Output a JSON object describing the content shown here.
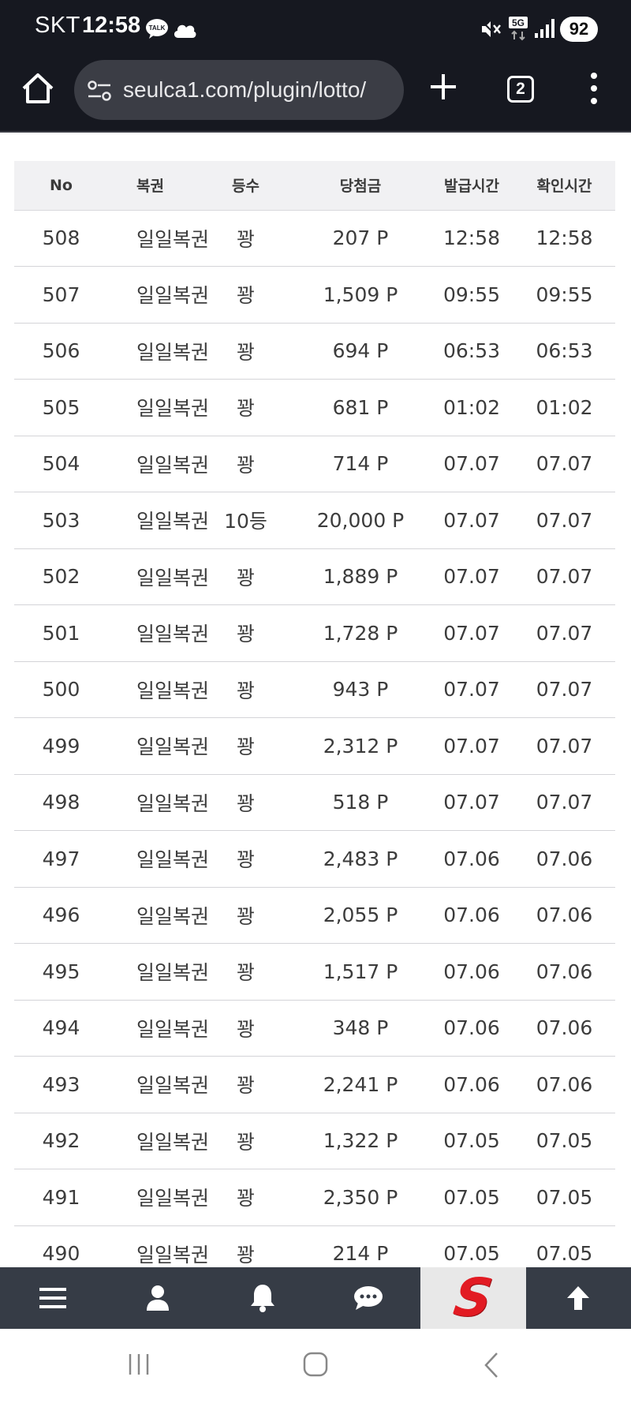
{
  "status_bar": {
    "carrier": "SKT",
    "time": "12:58",
    "talk_badge": "TALK",
    "network": "5G",
    "battery": "92"
  },
  "browser": {
    "url": "seulca1.com/plugin/lotto/",
    "tab_count": "2"
  },
  "table": {
    "headers": {
      "no": "No",
      "type": "복권",
      "rank": "등수",
      "prize": "당첨금",
      "issued": "발급시간",
      "checked": "확인시간"
    },
    "rows": [
      {
        "no": "508",
        "type": "일일복권",
        "rank": "꽝",
        "prize": "207 P",
        "issued": "12:58",
        "checked": "12:58"
      },
      {
        "no": "507",
        "type": "일일복권",
        "rank": "꽝",
        "prize": "1,509 P",
        "issued": "09:55",
        "checked": "09:55"
      },
      {
        "no": "506",
        "type": "일일복권",
        "rank": "꽝",
        "prize": "694 P",
        "issued": "06:53",
        "checked": "06:53"
      },
      {
        "no": "505",
        "type": "일일복권",
        "rank": "꽝",
        "prize": "681 P",
        "issued": "01:02",
        "checked": "01:02"
      },
      {
        "no": "504",
        "type": "일일복권",
        "rank": "꽝",
        "prize": "714 P",
        "issued": "07.07",
        "checked": "07.07"
      },
      {
        "no": "503",
        "type": "일일복권",
        "rank": "10등",
        "prize": "20,000 P",
        "issued": "07.07",
        "checked": "07.07"
      },
      {
        "no": "502",
        "type": "일일복권",
        "rank": "꽝",
        "prize": "1,889 P",
        "issued": "07.07",
        "checked": "07.07"
      },
      {
        "no": "501",
        "type": "일일복권",
        "rank": "꽝",
        "prize": "1,728 P",
        "issued": "07.07",
        "checked": "07.07"
      },
      {
        "no": "500",
        "type": "일일복권",
        "rank": "꽝",
        "prize": "943 P",
        "issued": "07.07",
        "checked": "07.07"
      },
      {
        "no": "499",
        "type": "일일복권",
        "rank": "꽝",
        "prize": "2,312 P",
        "issued": "07.07",
        "checked": "07.07"
      },
      {
        "no": "498",
        "type": "일일복권",
        "rank": "꽝",
        "prize": "518 P",
        "issued": "07.07",
        "checked": "07.07"
      },
      {
        "no": "497",
        "type": "일일복권",
        "rank": "꽝",
        "prize": "2,483 P",
        "issued": "07.06",
        "checked": "07.06"
      },
      {
        "no": "496",
        "type": "일일복권",
        "rank": "꽝",
        "prize": "2,055 P",
        "issued": "07.06",
        "checked": "07.06"
      },
      {
        "no": "495",
        "type": "일일복권",
        "rank": "꽝",
        "prize": "1,517 P",
        "issued": "07.06",
        "checked": "07.06"
      },
      {
        "no": "494",
        "type": "일일복권",
        "rank": "꽝",
        "prize": "348 P",
        "issued": "07.06",
        "checked": "07.06"
      },
      {
        "no": "493",
        "type": "일일복권",
        "rank": "꽝",
        "prize": "2,241 P",
        "issued": "07.06",
        "checked": "07.06"
      },
      {
        "no": "492",
        "type": "일일복권",
        "rank": "꽝",
        "prize": "1,322 P",
        "issued": "07.05",
        "checked": "07.05"
      },
      {
        "no": "491",
        "type": "일일복권",
        "rank": "꽝",
        "prize": "2,350 P",
        "issued": "07.05",
        "checked": "07.05"
      },
      {
        "no": "490",
        "type": "일일복권",
        "rank": "꽝",
        "prize": "214 P",
        "issued": "07.05",
        "checked": "07.05"
      }
    ]
  },
  "bottom_nav": {
    "items": [
      "menu-icon",
      "user-icon",
      "bell-icon",
      "chat-icon",
      "site-logo",
      "arrow-up-icon"
    ],
    "logo_letter": "S"
  },
  "colors": {
    "status_bar_bg": "#161820",
    "url_box_bg": "#3b3d45",
    "header_row_bg": "#f1f1f3",
    "bottom_nav_bg": "#363c46",
    "logo_red": "#e21b23"
  }
}
